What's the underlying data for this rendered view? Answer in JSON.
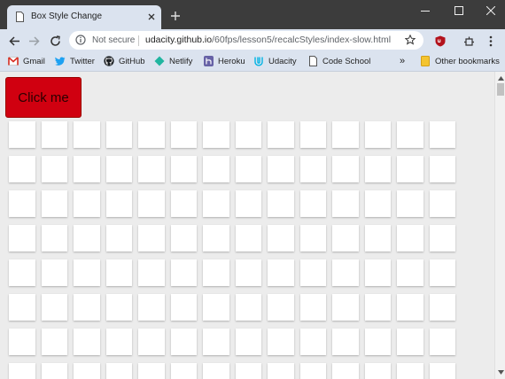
{
  "tab": {
    "title": "Box Style Change",
    "favicon": "page-icon"
  },
  "window_controls": [
    "minimize-icon",
    "maximize-icon",
    "close-icon"
  ],
  "omnibox": {
    "security_text": "Not secure",
    "host": "udacity.github.io",
    "path": "/60fps/lesson5/recalcStyles/index-slow.html"
  },
  "bookmarks": {
    "items": [
      {
        "label": "Gmail",
        "icon": "gmail-icon"
      },
      {
        "label": "Twitter",
        "icon": "twitter-icon"
      },
      {
        "label": "GitHub",
        "icon": "github-icon"
      },
      {
        "label": "Netlify",
        "icon": "netlify-icon"
      },
      {
        "label": "Heroku",
        "icon": "heroku-icon"
      },
      {
        "label": "Udacity",
        "icon": "udacity-icon"
      },
      {
        "label": "Code School",
        "icon": "page-icon"
      }
    ],
    "overflow": "»",
    "other": "Other bookmarks"
  },
  "page": {
    "button_label": "Click me",
    "grid_columns": 14,
    "grid_rows_visible": 8
  },
  "colors": {
    "button": "#d00010",
    "chrome_bar": "#dbe3ef",
    "content_bg": "#ececec"
  }
}
